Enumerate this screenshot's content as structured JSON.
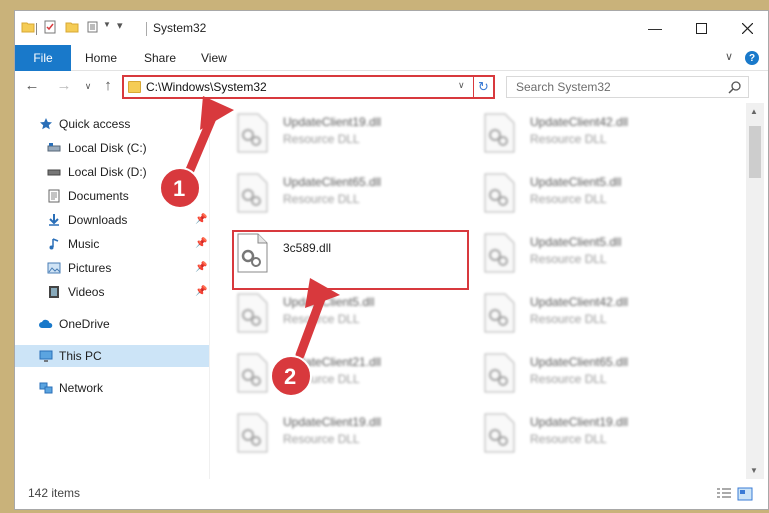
{
  "window": {
    "title": "System32",
    "controls": [
      "minimize-icon",
      "maximize-icon",
      "close-icon"
    ]
  },
  "ribbon": {
    "file_tab": "File",
    "tabs": [
      "Home",
      "Share",
      "View"
    ]
  },
  "address": {
    "path": "C:\\Windows\\System32"
  },
  "search": {
    "placeholder": "Search System32"
  },
  "nav": {
    "items": [
      {
        "label": "Quick access",
        "icon": "star-icon"
      },
      {
        "label": "Local Disk (C:)",
        "icon": "drive-icon"
      },
      {
        "label": "Local Disk (D:)",
        "icon": "drive-icon"
      },
      {
        "label": "Documents",
        "icon": "documents-icon"
      },
      {
        "label": "Downloads",
        "icon": "download-icon"
      },
      {
        "label": "Music",
        "icon": "music-icon"
      },
      {
        "label": "Pictures",
        "icon": "pictures-icon"
      },
      {
        "label": "Videos",
        "icon": "videos-icon"
      },
      {
        "label": "OneDrive",
        "icon": "cloud-icon"
      },
      {
        "label": "This PC",
        "icon": "computer-icon"
      },
      {
        "label": "Network",
        "icon": "network-icon"
      }
    ]
  },
  "files": {
    "type_label": "Resource DLL",
    "highlighted": {
      "name": "3c589.dll"
    },
    "left_column": [
      "UpdateClient19.dll",
      "UpdateClient65.dll",
      "3c589.dll",
      "UpdateClient5.dll",
      "UpdateClient21.dll",
      "UpdateClient19.dll"
    ],
    "right_column": [
      "UpdateClient42.dll",
      "UpdateClient5.dll",
      "UpdateClient5.dll",
      "UpdateClient42.dll",
      "UpdateClient65.dll",
      "UpdateClient19.dll"
    ]
  },
  "status": {
    "item_count": "142 items"
  },
  "annotations": {
    "step1": "1",
    "step2": "2",
    "color": "#d8393d"
  }
}
